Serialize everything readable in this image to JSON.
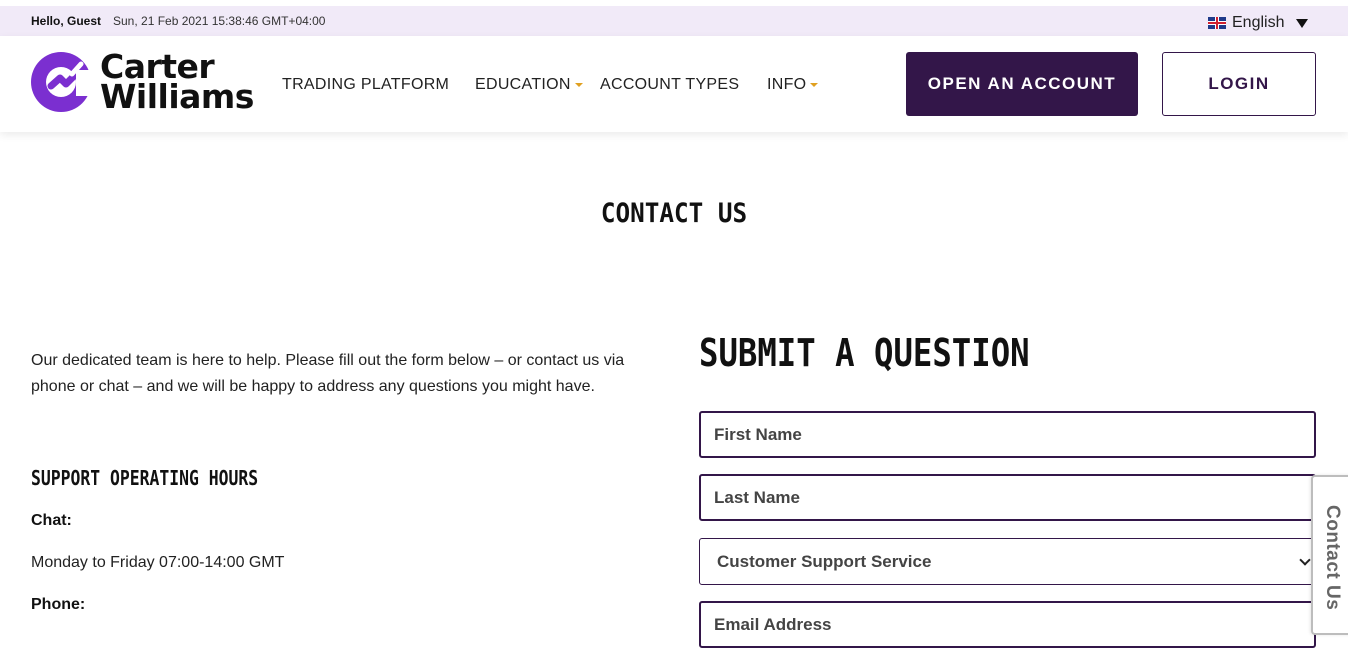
{
  "topbar": {
    "greeting": "Hello, Guest",
    "datetime": "Sun, 21 Feb 2021 15:38:46 GMT+04:00",
    "language": "English"
  },
  "header": {
    "logo_line1": "Carter",
    "logo_line2": "Williams",
    "nav": {
      "trading_platform": "TRADING PLATFORM",
      "education": "EDUCATION",
      "account_types": "ACCOUNT TYPES",
      "info": "INFO"
    },
    "open_account": "OPEN AN ACCOUNT",
    "login": "LOGIN"
  },
  "page": {
    "title": "CONTACT US"
  },
  "support": {
    "intro": "Our dedicated team is here to help. Please fill out the form below – or contact us via phone or chat – and we will be happy to address any questions you might have.",
    "hours_title": "SUPPORT OPERATING HOURS",
    "chat_label": "Chat:",
    "chat_hours": "Monday to Friday 07:00-14:00 GMT",
    "phone_label": "Phone:"
  },
  "form": {
    "title": "SUBMIT A QUESTION",
    "first_name_placeholder": "First Name",
    "last_name_placeholder": "Last Name",
    "department_selected": "Customer Support Service",
    "email_placeholder": "Email Address"
  },
  "side_tab": {
    "label": "Contact Us"
  },
  "colors": {
    "brand_purple": "#331649",
    "logo_purple": "#7b2fd0",
    "accent_orange": "#e0a020",
    "topbar_bg": "#f1eaf8"
  }
}
